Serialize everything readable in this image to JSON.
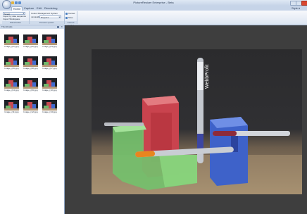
{
  "window": {
    "title": "PictureResizer Enterprise - Beta",
    "controls": [
      "minimize",
      "maximize",
      "close"
    ]
  },
  "ribbon": {
    "tabs": [
      "Home",
      "Capture",
      "Edit",
      "Rendering"
    ],
    "active_tab": "Home",
    "style_menu": "Style ▾",
    "groups": {
      "placeholder_group": {
        "label": "Placeholder",
        "combo_value": "Smart",
        "rows": [
          "Import by date sequence",
          "Import Workspace"
        ]
      },
      "preview_system": {
        "label": "Preview system",
        "rows": [
          "Colour Management System"
        ],
        "combo_label": "Jemaside",
        "combo_value": "Project1"
      },
      "launch_render": {
        "label": "Launch render",
        "buttons": [
          "Cancel",
          "Save"
        ]
      }
    }
  },
  "thumbnails_panel": {
    "title": "Thumbnails",
    "items": [
      "Image_(01).jpg",
      "Image_(02).jpg",
      "Image_(04).jpg",
      "Image_(06).jpg",
      "Image_(08).jpg",
      "Image_(07).jpg",
      "Image_(04).jpg",
      "Image_(09).jpg",
      "Image_(10).jpg",
      "Image_(11).jpg",
      "Image_(12).jpg",
      "Image_(13).jpg"
    ]
  },
  "photo": {
    "pen_brand": "WebbProfit"
  },
  "colors": {
    "ribbon_bg": "#dce5f1",
    "viewer_bg": "#3e3e3e",
    "close_button": "#d9462f"
  }
}
